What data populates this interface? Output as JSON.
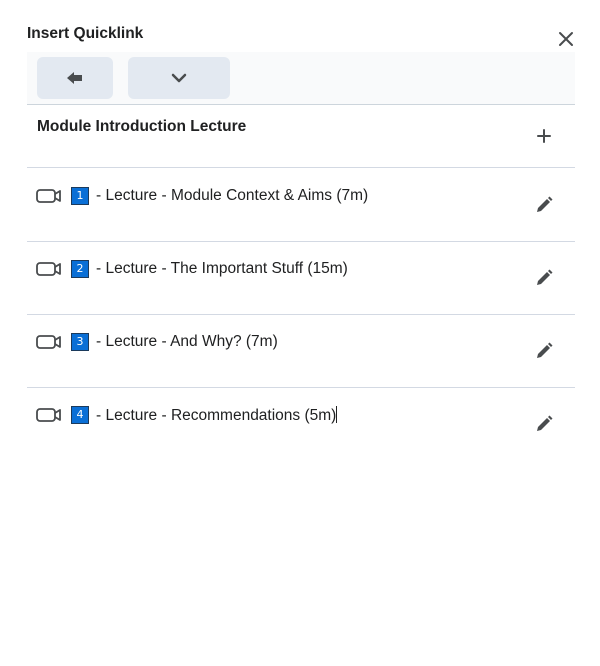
{
  "dialog": {
    "title": "Insert Quicklink",
    "close_icon": "close-icon"
  },
  "toolbar": {
    "back_icon": "arrow-left-icon",
    "more_icon": "chevron-down-icon"
  },
  "section": {
    "title": "Module Introduction Lecture",
    "add_icon": "plus-icon"
  },
  "items": [
    {
      "number": "1",
      "label": "- Lecture - Module Context & Aims (7m)",
      "icon": "video-icon",
      "edit_icon": "pencil-icon"
    },
    {
      "number": "2",
      "label": "- Lecture - The Important Stuff (15m)",
      "icon": "video-icon",
      "edit_icon": "pencil-icon"
    },
    {
      "number": "3",
      "label": "- Lecture - And Why? (7m)",
      "icon": "video-icon",
      "edit_icon": "pencil-icon"
    },
    {
      "number": "4",
      "label": "- Lecture - Recommendations (5m)",
      "icon": "video-icon",
      "edit_icon": "pencil-icon"
    }
  ],
  "colors": {
    "badge": "#0a6fd6",
    "toolbar_button": "#e3e9f1",
    "divider": "#d3d9e3"
  }
}
